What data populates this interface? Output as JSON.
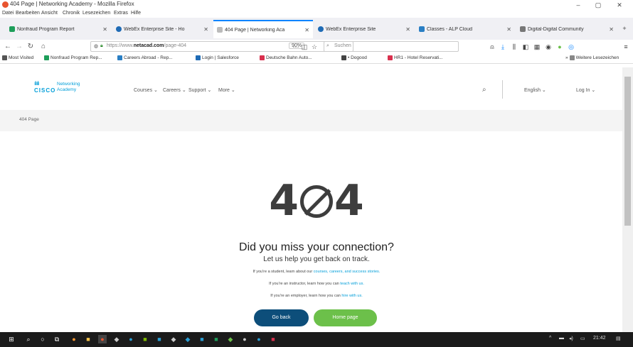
{
  "window": {
    "title": "404 Page | Networking Academy - Mozilla Firefox",
    "controls": [
      "–",
      "▢",
      "✕"
    ]
  },
  "menu": [
    "Datei",
    "Bearbeiten",
    "Ansicht",
    "Chronik",
    "Lesezeichen",
    "Extras",
    "Hilfe"
  ],
  "tabs": [
    {
      "label": "Nonfraud Program Report",
      "color": "#1e9e5a",
      "active": false
    },
    {
      "label": "WebEx Enterprise Site - Ho",
      "color": "#1f6bb5",
      "active": false
    },
    {
      "label": "404 Page | Networking Aca",
      "color": "#999999",
      "active": true
    },
    {
      "label": "WebEx Enterprise Site",
      "color": "#1f6bb5",
      "active": false
    },
    {
      "label": "Classes - ALP Cloud",
      "color": "#2a7fc4",
      "active": false
    },
    {
      "label": "Digital-Digital Community",
      "color": "#777777",
      "active": false
    }
  ],
  "nav": {
    "url_prefix": "https://www.",
    "url_domain": "netacad.com",
    "url_path": "/page-404",
    "zoom": "90%",
    "search_placeholder": "Suchen"
  },
  "bookmarks": [
    {
      "label": "Most Visited",
      "color": "#555555"
    },
    {
      "label": "Nonfraud Program Rep...",
      "color": "#1e9e5a"
    },
    {
      "label": "Careers Abroad - Rep...",
      "color": "#2a7fc4"
    },
    {
      "label": "Login | Salesforce",
      "color": "#1f6bb5"
    },
    {
      "label": "Deutsche Bahn Auto...",
      "color": "#d9304e"
    },
    {
      "label": "• Dogood",
      "color": "#444444"
    },
    {
      "label": "HR1 - Hotel Reservati...",
      "color": "#d9304e"
    },
    {
      "label": "Weitere Lesezeichen",
      "color": "#555555"
    }
  ],
  "site": {
    "brand_bars": "ılıılı",
    "brand_name": "CISCO",
    "academy_line1": "Networking",
    "academy_line2": "Academy",
    "nav_links": [
      "Courses ⌄",
      "Careers ⌄",
      "Support ⌄",
      "More ⌄"
    ],
    "language": "English ⌄",
    "login": "Log In ⌄",
    "breadcrumb": "404 Page"
  },
  "error": {
    "code_left": "4",
    "code_right": "4",
    "heading": "Did you miss your connection?",
    "subheading": "Let us help you get back on track.",
    "line1_text": "If you're a student, learn about our ",
    "line1_link": "courses, careers, and success stories.",
    "line2_text": "If you're an instructor, learn how you can ",
    "line2_link": "teach with us.",
    "line3_text": "If you're an employer, learn how you can ",
    "line3_link": "hire with us.",
    "back_button": "Go back",
    "home_button": "Home page"
  },
  "colors": {
    "accent": "#049fd9",
    "back_button": "#0d4e7a",
    "home_button": "#6cc04a"
  },
  "taskbar": {
    "time": "21:42"
  }
}
